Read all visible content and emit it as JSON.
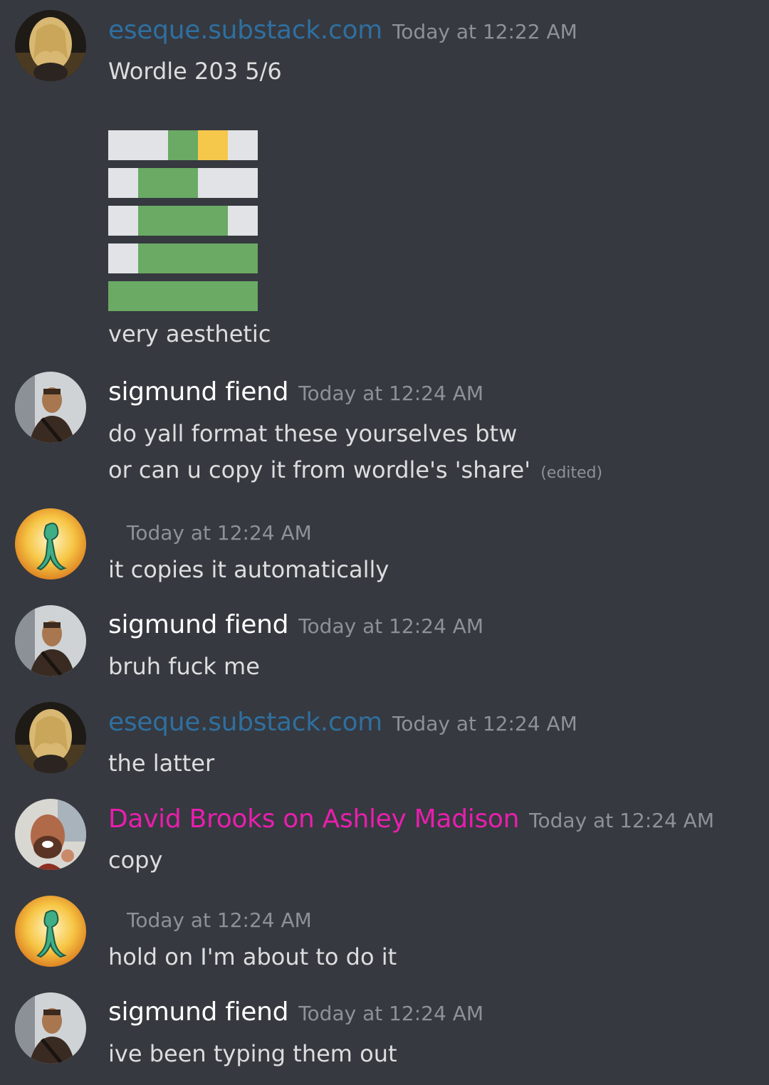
{
  "colors": {
    "background": "#36393f",
    "text": "#dcddde",
    "timestamp": "#8e9297",
    "blue_user": "#2f6fa0",
    "white_user": "#ffffff",
    "pink_user": "#e91eae",
    "wordle_green": "#6aaa64",
    "wordle_yellow": "#f5c84c",
    "wordle_blank": "#e1e3e6"
  },
  "messages": [
    {
      "username": "eseque.substack.com",
      "timestamp": "Today at 12:22 AM",
      "avatar_icon": "blonde-portrait-avatar",
      "lines": [
        "Wordle 203 5/6",
        "very aesthetic"
      ],
      "wordle_grid": [
        [
          "w",
          "w",
          "g",
          "y",
          "w"
        ],
        [
          "w",
          "g",
          "g",
          "w",
          "w"
        ],
        [
          "w",
          "g",
          "g",
          "g",
          "w"
        ],
        [
          "w",
          "g",
          "g",
          "g",
          "g"
        ],
        [
          "g",
          "g",
          "g",
          "g",
          "g"
        ]
      ]
    },
    {
      "username": "sigmund fiend",
      "timestamp": "Today at 12:24 AM",
      "avatar_icon": "action-hero-avatar",
      "lines": [
        "do yall format these yourselves btw",
        "or can u copy it from wordle's 'share'"
      ],
      "edited": "(edited)"
    },
    {
      "username": "",
      "timestamp": "Today at 12:24 AM",
      "avatar_icon": "bold-squidward-avatar",
      "lines": [
        "it copies it automatically"
      ]
    },
    {
      "username": "sigmund fiend",
      "timestamp": "Today at 12:24 AM",
      "avatar_icon": "action-hero-avatar",
      "lines": [
        "bruh fuck me"
      ]
    },
    {
      "username": "eseque.substack.com",
      "timestamp": "Today at 12:24 AM",
      "avatar_icon": "blonde-portrait-avatar",
      "lines": [
        "the latter"
      ]
    },
    {
      "username": "David Brooks on Ashley Madison",
      "timestamp": "Today at 12:24 AM",
      "avatar_icon": "bearded-man-avatar",
      "lines": [
        "copy"
      ]
    },
    {
      "username": "",
      "timestamp": "Today at 12:24 AM",
      "avatar_icon": "bold-squidward-avatar",
      "lines": [
        "hold on I'm about to do it"
      ]
    },
    {
      "username": "sigmund fiend",
      "timestamp": "Today at 12:24 AM",
      "avatar_icon": "action-hero-avatar",
      "lines": [
        "ive been typing them out"
      ]
    }
  ]
}
